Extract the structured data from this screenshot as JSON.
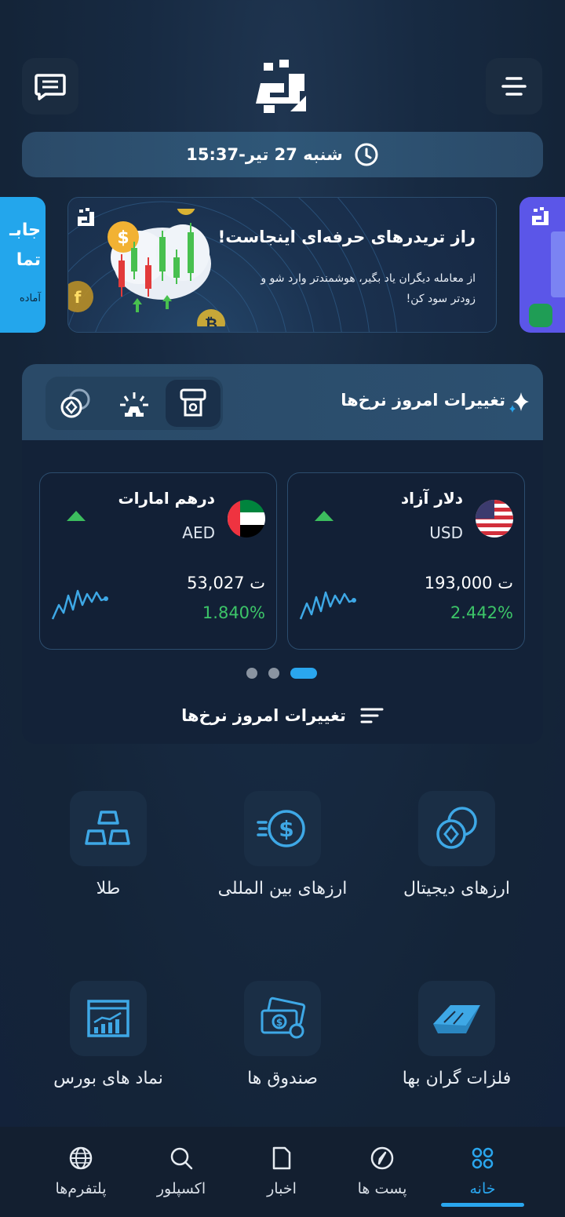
{
  "header": {
    "date_text": "شنبه 27 تیر-15:37"
  },
  "banner": {
    "title": "راز تریدرهای حرفه‌ای اینجاست!",
    "subtitle": "از معامله دیگران یاد بگیر، هوشمندتر وارد شو و زودتر سود کن!",
    "left_peek_line1": "جابـ",
    "left_peek_line2": "تما",
    "left_peek_line3": "آماده"
  },
  "rates": {
    "title": "تغییرات امروز نرخ‌ها",
    "footer_label": "تغییرات امروز نرخ‌ها",
    "cards": [
      {
        "name": "دلار آزاد",
        "code": "USD",
        "price": "ت 193,000",
        "change": "2.442%",
        "trend": "up"
      },
      {
        "name": "درهم امارات",
        "code": "AED",
        "price": "ت 53,027",
        "change": "1.840%",
        "trend": "up"
      }
    ],
    "carousel": {
      "count": 3,
      "active_index": 0
    }
  },
  "categories": [
    {
      "label": "ارزهای دیجیتال",
      "icon": "crypto-coins-icon"
    },
    {
      "label": "ارزهای بین المللی",
      "icon": "dollar-exchange-icon"
    },
    {
      "label": "طلا",
      "icon": "gold-bars-icon"
    },
    {
      "label": "فلزات گران بها",
      "icon": "metal-ingot-icon"
    },
    {
      "label": "صندوق ها",
      "icon": "money-fund-icon"
    },
    {
      "label": "نماد های بورس",
      "icon": "stock-chart-icon"
    }
  ],
  "nav": {
    "items": [
      {
        "label": "خانه",
        "icon": "home-grid-icon",
        "active": true
      },
      {
        "label": "پست ها",
        "icon": "compass-icon",
        "active": false
      },
      {
        "label": "اخبار",
        "icon": "document-icon",
        "active": false
      },
      {
        "label": "اکسپلور",
        "icon": "search-icon",
        "active": false
      },
      {
        "label": "پلتفرم‌ها",
        "icon": "globe-icon",
        "active": false
      }
    ]
  },
  "colors": {
    "accent": "#2aa6ee",
    "positive": "#3cc468",
    "background": "#142438"
  }
}
